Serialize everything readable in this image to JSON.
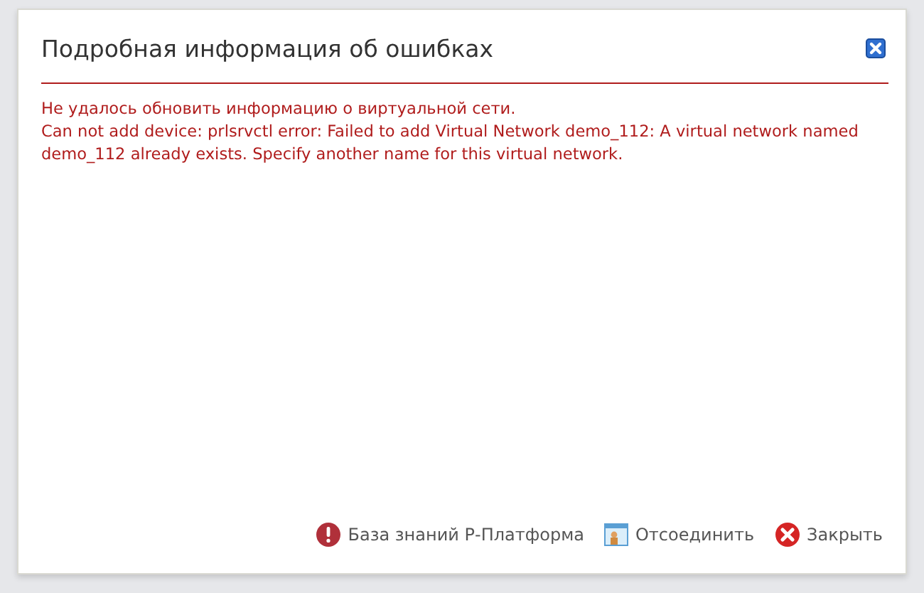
{
  "dialog": {
    "title": "Подробная информация об ошибках",
    "message_lines": [
      "Не удалось обновить информацию о виртуальной сети.",
      "Can not add device: prlsrvctl error: Failed to add Virtual Network demo_112: A virtual network named demo_112 already exists. Specify another name for this virtual network."
    ],
    "buttons": [
      {
        "label": "База знаний Р-Платформа",
        "kind": "help"
      },
      {
        "label": "Отсоединить",
        "kind": "detach"
      },
      {
        "label": "Закрыть",
        "kind": "close"
      }
    ]
  }
}
